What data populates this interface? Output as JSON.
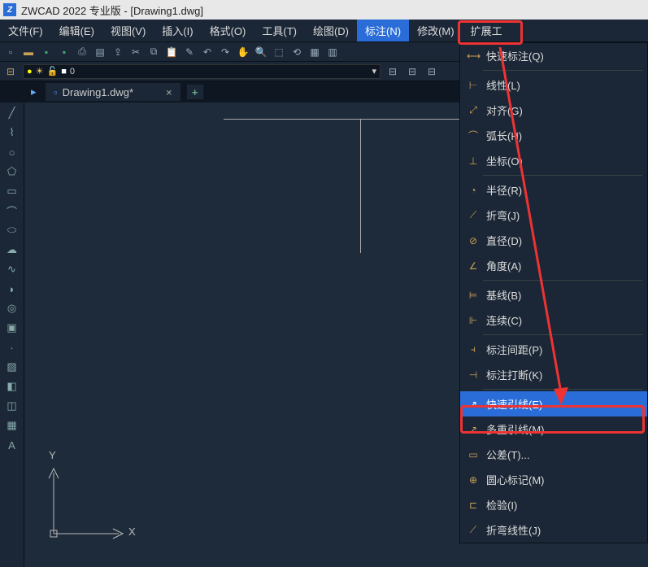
{
  "title": "ZWCAD 2022 专业版 - [Drawing1.dwg]",
  "menus": {
    "file": "文件(F)",
    "edit": "编辑(E)",
    "view": "视图(V)",
    "insert": "插入(I)",
    "format": "格式(O)",
    "tools": "工具(T)",
    "draw": "绘图(D)",
    "dim": "标注(N)",
    "modify": "修改(M)",
    "ext": "扩展工"
  },
  "layer": {
    "current": "0"
  },
  "tab": {
    "name": "Drawing1.dwg*",
    "close": "×",
    "new": "+"
  },
  "ucs": {
    "x": "X",
    "y": "Y"
  },
  "dropdown": {
    "quickdim": "快速标注(Q)",
    "linear": "线性(L)",
    "aligned": "对齐(G)",
    "arc": "弧长(H)",
    "ordinate": "坐标(O)",
    "radius": "半径(R)",
    "jogged": "折弯(J)",
    "diameter": "直径(D)",
    "angular": "角度(A)",
    "baseline": "基线(B)",
    "continue": "连续(C)",
    "space": "标注间距(P)",
    "break": "标注打断(K)",
    "qleader": "快速引线(E)",
    "mleader": "多重引线(M)",
    "tolerance": "公差(T)...",
    "center": "圆心标记(M)",
    "inspect": "检验(I)",
    "joglinear": "折弯线性(J)"
  },
  "colors": {
    "accent": "#2a6dd8",
    "highlight": "#e33"
  }
}
